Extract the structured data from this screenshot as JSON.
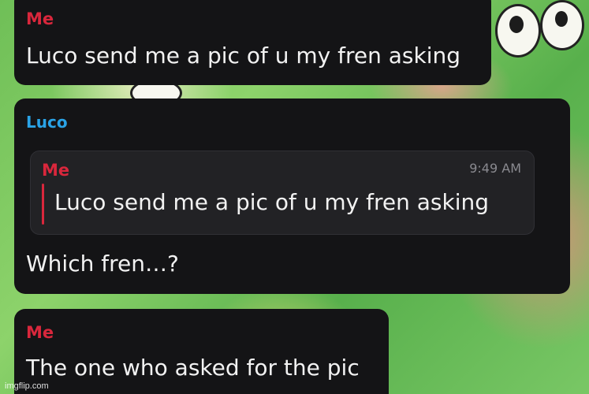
{
  "messages": [
    {
      "sender": "Me",
      "text": "Luco send me a pic of u my fren asking"
    },
    {
      "sender": "Luco",
      "reply_to": {
        "sender": "Me",
        "time": "9:49 AM",
        "text": "Luco send me a pic of u my fren asking"
      },
      "text": "Which fren…?"
    },
    {
      "sender": "Me",
      "text": "The one who asked for the pic"
    }
  ],
  "watermark": "imgflip.com",
  "colors": {
    "me_sender": "#d9273c",
    "luco_sender": "#2aa3e6",
    "bubble_bg": "#141416",
    "quote_bg": "#222225"
  }
}
